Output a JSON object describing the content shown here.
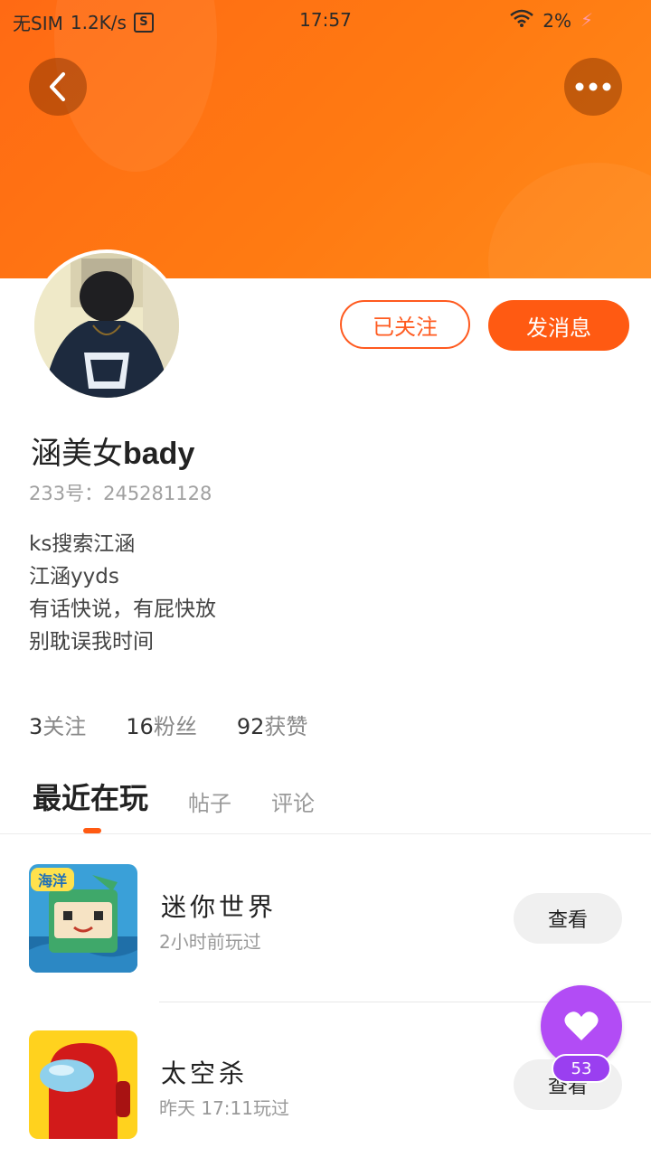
{
  "status_bar": {
    "carrier": "无SIM",
    "speed": "1.2K/s",
    "s_badge": "S",
    "time": "17:57",
    "battery": "2%"
  },
  "header": {
    "back_icon": "chevron-left-icon",
    "more_icon": "more-dots-icon",
    "gradient_start": "#ff6a14",
    "gradient_end": "#ff8a1a"
  },
  "profile": {
    "name": "涵美女",
    "name_suffix": "bady",
    "id_label": "233号：",
    "id_value": "245281128",
    "follow_label": "已关注",
    "message_label": "发消息",
    "bio": [
      "ks搜索江涵",
      "江涵yyds",
      "有话快说，有屁快放",
      "别耽误我时间"
    ]
  },
  "stats": [
    {
      "value": "3",
      "label": "关注"
    },
    {
      "value": "16",
      "label": "粉丝"
    },
    {
      "value": "92",
      "label": "获赞"
    }
  ],
  "tabs": [
    {
      "label": "最近在玩",
      "active": true
    },
    {
      "label": "帖子",
      "active": false
    },
    {
      "label": "评论",
      "active": false
    }
  ],
  "games": [
    {
      "name": "迷你世界",
      "sub": "2小时前玩过",
      "button": "查看",
      "icon_text": "海洋"
    },
    {
      "name": "太空杀",
      "sub": "昨天 17:11玩过",
      "button": "查看"
    }
  ],
  "like": {
    "count": "53",
    "icon": "heart-icon",
    "color": "#b24cf5"
  },
  "accent_color": "#ff5a12"
}
